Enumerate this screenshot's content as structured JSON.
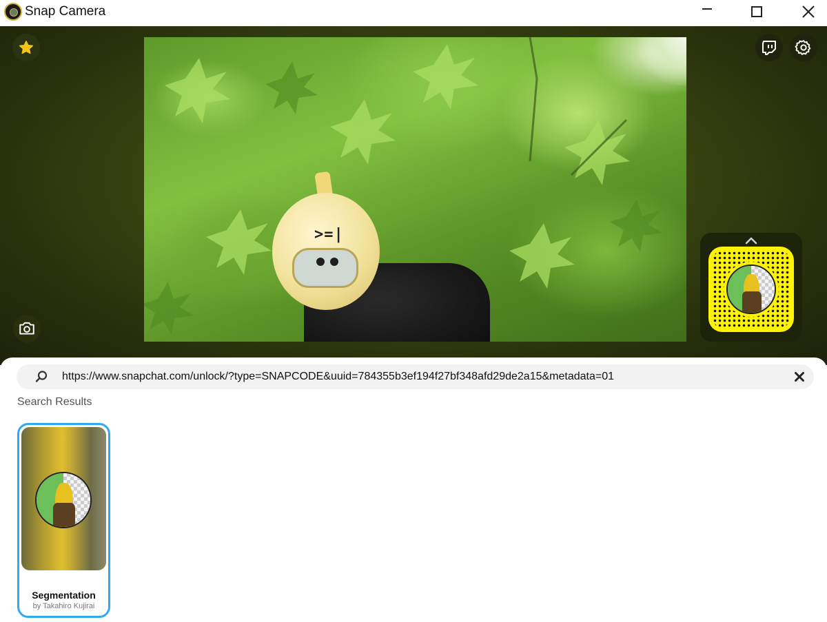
{
  "window": {
    "title": "Snap Camera",
    "controls": [
      "minimize",
      "maximize",
      "close"
    ]
  },
  "camera": {
    "toolbar": {
      "favorites_icon": "star-icon",
      "twitch_icon": "twitch-icon",
      "settings_icon": "gear-icon",
      "snapshot_icon": "camera-icon"
    },
    "preview": {
      "face_text": ">=|"
    },
    "active_lens": {
      "snapcode_icon": "snapcode",
      "expand_icon": "chevron-up-icon"
    }
  },
  "search": {
    "value": "https://www.snapchat.com/unlock/?type=SNAPCODE&uuid=784355b3ef194f27bf348afd29de2a15&metadata=01",
    "clear_icon": "close-icon"
  },
  "results": {
    "heading": "Search Results",
    "items": [
      {
        "name": "Segmentation",
        "author": "by Takahiro Kujirai",
        "selected": true
      }
    ]
  },
  "colors": {
    "accent": "#2fa9f0",
    "snapcode_yellow": "#fff400",
    "star": "#f5c518"
  }
}
